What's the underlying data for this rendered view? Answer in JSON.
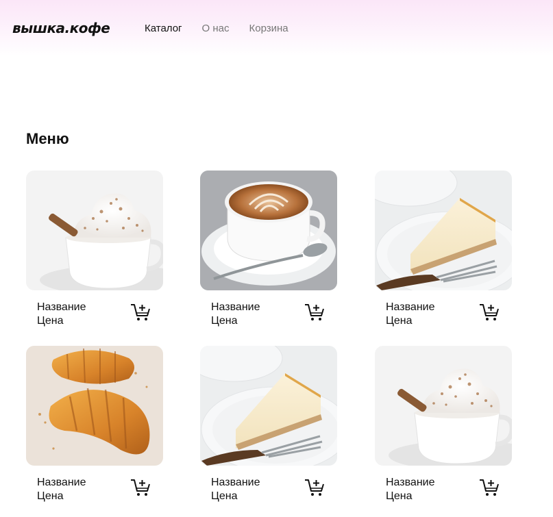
{
  "header": {
    "logo": "вышка.кофе",
    "nav": [
      {
        "label": "Каталог",
        "active": true
      },
      {
        "label": "О нас",
        "active": false
      },
      {
        "label": "Корзина",
        "active": false
      }
    ]
  },
  "main": {
    "title": "Меню",
    "products": [
      {
        "name": "Название",
        "price": "Цена",
        "image": "cappuccino-cinnamon",
        "cart_icon": "add-to-cart-icon"
      },
      {
        "name": "Название",
        "price": "Цена",
        "image": "latte-art",
        "cart_icon": "add-to-cart-icon"
      },
      {
        "name": "Название",
        "price": "Цена",
        "image": "cheesecake",
        "cart_icon": "add-to-cart-icon"
      },
      {
        "name": "Название",
        "price": "Цена",
        "image": "croissants",
        "cart_icon": "add-to-cart-icon"
      },
      {
        "name": "Название",
        "price": "Цена",
        "image": "cheesecake",
        "cart_icon": "add-to-cart-icon"
      },
      {
        "name": "Название",
        "price": "Цена",
        "image": "cappuccino-cinnamon",
        "cart_icon": "add-to-cart-icon"
      }
    ]
  }
}
